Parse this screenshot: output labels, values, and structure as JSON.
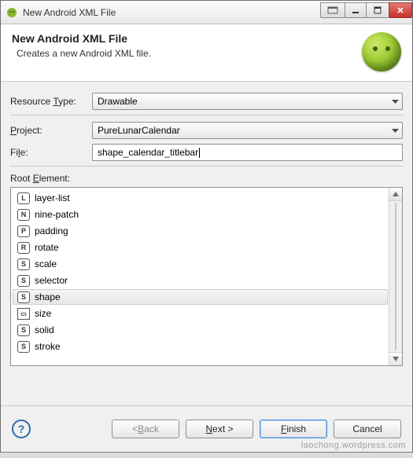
{
  "window": {
    "title": "New Android XML File"
  },
  "header": {
    "title": "New Android XML File",
    "subtitle": "Creates a new Android XML file."
  },
  "form": {
    "resource_type": {
      "label_pre": "Resource ",
      "label_mn": "T",
      "label_post": "ype:",
      "value": "Drawable"
    },
    "project": {
      "label_mn": "P",
      "label_post": "roject:",
      "value": "PureLunarCalendar"
    },
    "file": {
      "label_pre": "Fi",
      "label_mn": "l",
      "label_post": "e:",
      "value": "shape_calendar_titlebar"
    }
  },
  "root": {
    "label_pre": "Root ",
    "label_mn": "E",
    "label_post": "lement:",
    "items": [
      {
        "glyph": "L",
        "label": "layer-list"
      },
      {
        "glyph": "N",
        "label": "nine-patch"
      },
      {
        "glyph": "P",
        "label": "padding"
      },
      {
        "glyph": "R",
        "label": "rotate"
      },
      {
        "glyph": "S",
        "label": "scale"
      },
      {
        "glyph": "S",
        "label": "selector"
      },
      {
        "glyph": "S",
        "label": "shape"
      },
      {
        "glyph": "▭",
        "label": "size",
        "square": true
      },
      {
        "glyph": "S",
        "label": "solid"
      },
      {
        "glyph": "S",
        "label": "stroke"
      }
    ],
    "selected_index": 6
  },
  "buttons": {
    "back_pre": "< ",
    "back_mn": "B",
    "back_post": "ack",
    "next_mn": "N",
    "next_post": "ext >",
    "finish_mn": "F",
    "finish_post": "inish",
    "cancel": "Cancel"
  },
  "watermark": "laochong.wordpress.com"
}
